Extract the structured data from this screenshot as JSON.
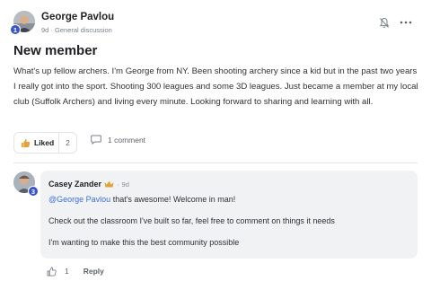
{
  "post": {
    "author": "George Pavlou",
    "author_level": "1",
    "time": "9d",
    "separator": "·",
    "category": "General discussion",
    "title": "New member",
    "body": "What's up fellow archers. I'm George from NY. Been shooting archery since a kid but in the past two years I really got into the sport. Shooting 300 leagues and some 3D leagues. Just became a member at my local club (Suffolk Archers) and living every minute. Looking forward to sharing and learning with all.",
    "like_label": "Liked",
    "like_count": "2",
    "comment_label": "1 comment",
    "icons": {
      "like": "thumbs-up-icon",
      "comment": "comment-bubble-icon",
      "bell": "bell-mute-icon",
      "more": "more-dots-icon"
    }
  },
  "comment": {
    "author": "Casey Zander",
    "author_level": "3",
    "badge_icon": "crown-icon",
    "time": "9d",
    "separator": "·",
    "mention": "@George Pavlou",
    "line1_rest": " that's awesome! Welcome in man!",
    "line2": "Check out the classroom I've built so far, feel free to comment on things it needs",
    "line3": "I'm wanting to make this the best community possible",
    "like_count": "1",
    "reply_label": "Reply"
  },
  "colors": {
    "accent": "#3b6fd8",
    "badge": "#3b54c4",
    "crown": "#e2a33a"
  }
}
